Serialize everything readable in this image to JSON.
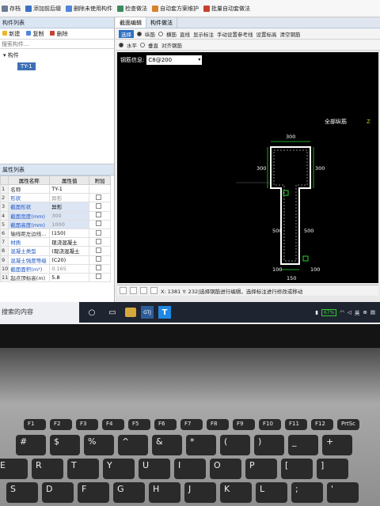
{
  "toolbar": {
    "items": [
      "存档",
      "添加前后缀",
      "删除未使用构件",
      "检查做法",
      "自动套方案维护",
      "批量自动套做法"
    ]
  },
  "component_list": {
    "title": "构件列表",
    "actions": [
      "新建",
      "复制",
      "删除"
    ],
    "search_placeholder": "搜索构件...",
    "tree_root": "构件",
    "tree_child": "TY-1"
  },
  "property_list": {
    "title": "属性列表",
    "headers": [
      "",
      "属性名称",
      "属性值",
      "附加"
    ],
    "rows": [
      {
        "n": "1",
        "name": "名称",
        "value": "TY-1",
        "blue": false,
        "grey": false,
        "hl": false
      },
      {
        "n": "2",
        "name": "形状",
        "value": "异形",
        "blue": true,
        "grey": true,
        "hl": false
      },
      {
        "n": "3",
        "name": "截面形状",
        "value": "异形",
        "blue": true,
        "grey": false,
        "hl": true
      },
      {
        "n": "4",
        "name": "截面宽度(mm)",
        "value": "300",
        "blue": true,
        "grey": true,
        "hl": true
      },
      {
        "n": "5",
        "name": "截面高度(mm)",
        "value": "1000",
        "blue": true,
        "grey": true,
        "hl": true
      },
      {
        "n": "6",
        "name": "轴线距左边线...",
        "value": "(150)",
        "blue": false,
        "grey": false,
        "hl": false
      },
      {
        "n": "7",
        "name": "材质",
        "value": "现浇混凝土",
        "blue": true,
        "grey": false,
        "hl": false
      },
      {
        "n": "8",
        "name": "混凝土类型",
        "value": "(现浇混凝土",
        "blue": true,
        "grey": false,
        "hl": false
      },
      {
        "n": "9",
        "name": "混凝土强度等级",
        "value": "(C20)",
        "blue": true,
        "grey": false,
        "hl": false
      },
      {
        "n": "10",
        "name": "截面面积(m²)",
        "value": "0.165",
        "blue": true,
        "grey": true,
        "hl": false
      },
      {
        "n": "11",
        "name": "起点顶标高(m)",
        "value": "5.8",
        "blue": false,
        "grey": false,
        "hl": false
      }
    ]
  },
  "editor": {
    "tabs": [
      "截面编辑",
      "构件做法"
    ],
    "tools": [
      "选择",
      "纵筋",
      "横筋",
      "直线",
      "显示标注",
      "手动设置参考线",
      "设置标高",
      "清空钢筋"
    ],
    "radios": [
      "水平",
      "垂直"
    ],
    "align_label": "对齐钢筋",
    "rebar_label": "钢筋信息:",
    "rebar_value": "C8@200",
    "rebar_caption": "全部纵筋",
    "dims": {
      "top": "300",
      "left_upper": "300",
      "right_upper": "300",
      "left_mid": "500",
      "right_mid": "500",
      "left_low": "100",
      "right_low": "100",
      "bottom": "150"
    },
    "status_text": "X: 1381 Y: 232|选择钢筋进行编辑，选择标注进行修改或移动"
  },
  "taskbar": {
    "search_text": "搜索的内容",
    "battery": "67%"
  },
  "keyboard": {
    "row_fn": [
      "F1",
      "F2",
      "F3",
      "F4",
      "F5",
      "F6",
      "F7",
      "F8",
      "F9",
      "F10",
      "F11",
      "F12",
      "PrtSc"
    ],
    "row_num": [
      "#",
      "$",
      "%",
      "^",
      "&",
      "*",
      "(",
      ")",
      "_",
      "+"
    ],
    "row_num_lo": [
      "3",
      "4",
      "5",
      "6",
      "7",
      "8",
      "9",
      "0",
      "-",
      "="
    ],
    "row_q": [
      "E",
      "R",
      "T",
      "Y",
      "U",
      "I",
      "O",
      "P",
      "[",
      "]"
    ],
    "row_a": [
      "S",
      "D",
      "F",
      "G",
      "H",
      "J",
      "K",
      "L",
      ";",
      "'"
    ]
  },
  "colors": {
    "selected": "#2d6fc3",
    "rebar_highlight": "#2bd32b",
    "section_outline": "#ffffff"
  }
}
